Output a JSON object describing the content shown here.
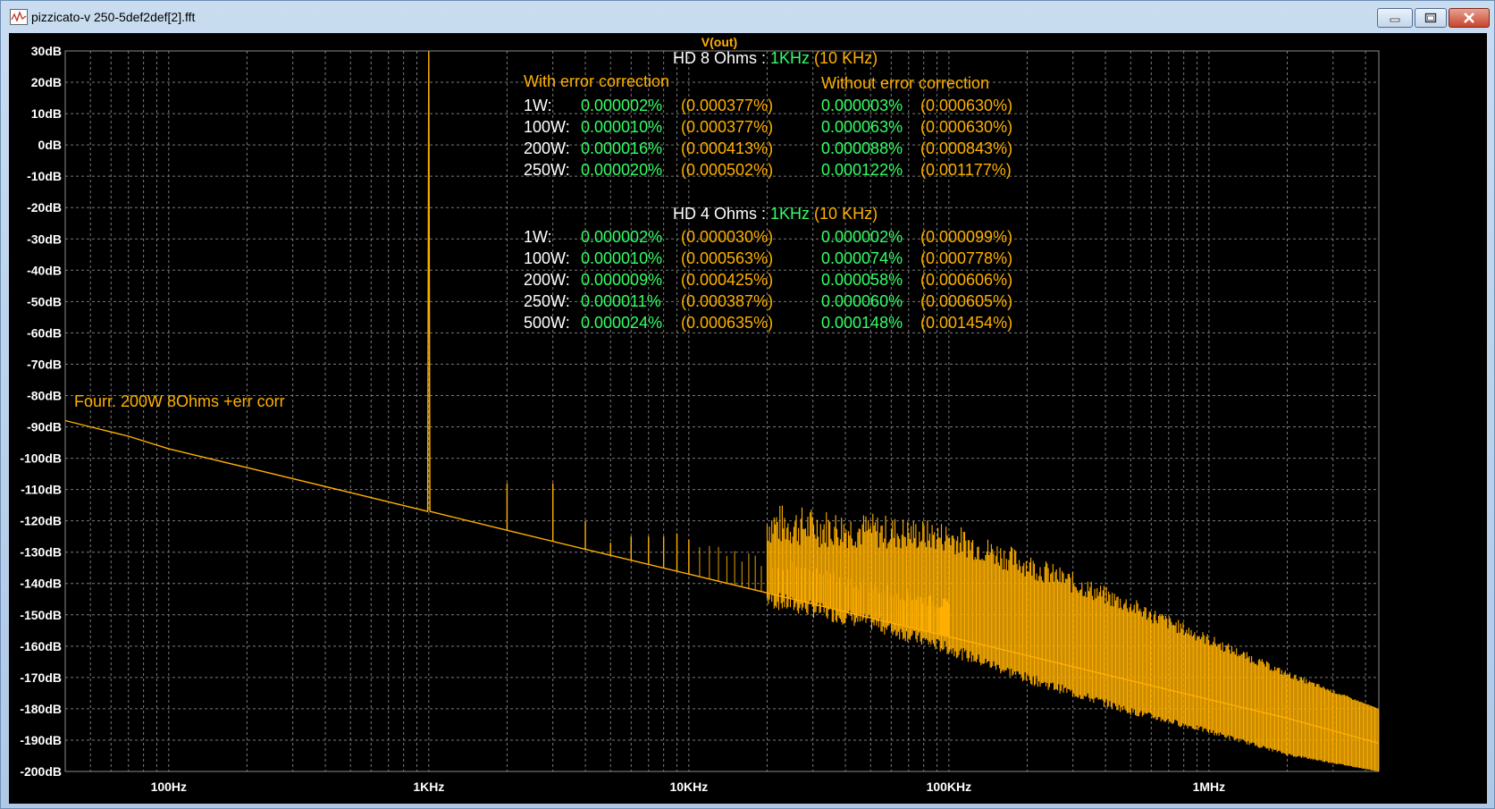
{
  "window": {
    "title": "pizzicato-v 250-5def2def[2].fft"
  },
  "colors": {
    "background": "#000000",
    "trace": "#ffb000",
    "grid": "#7a7a7a",
    "green_text": "#33ff66",
    "white_text": "#ffffff",
    "yellow_text": "#ffb000"
  },
  "icons": [
    "waveform-icon",
    "minimize-icon",
    "maximize-icon",
    "close-icon"
  ],
  "plot": {
    "trace_label": "V(out)",
    "x_ticks": [
      "100Hz",
      "1KHz",
      "10KHz",
      "100KHz",
      "1MHz"
    ],
    "y_ticks": [
      "30dB",
      "20dB",
      "10dB",
      "0dB",
      "-10dB",
      "-20dB",
      "-30dB",
      "-40dB",
      "-50dB",
      "-60dB",
      "-70dB",
      "-80dB",
      "-90dB",
      "-100dB",
      "-110dB",
      "-120dB",
      "-130dB",
      "-140dB",
      "-150dB",
      "-160dB",
      "-170dB",
      "-180dB",
      "-190dB",
      "-200dB"
    ],
    "annotation": "Fourr.  200W 8Ohms +err corr"
  },
  "hd8": {
    "title": "HD  8 Ohms : ",
    "fund": "1KHz",
    "alt": "  (10 KHz)",
    "with_label": "With error correction",
    "without_label": "Without error correction",
    "rows": [
      {
        "p": "1W:",
        "w1": "0.000002%",
        "w2": "(0.000377%)",
        "n1": "0.000003%",
        "n2": "(0.000630%)"
      },
      {
        "p": "100W:",
        "w1": "0.000010%",
        "w2": "(0.000377%)",
        "n1": "0.000063%",
        "n2": "(0.000630%)"
      },
      {
        "p": "200W:",
        "w1": "0.000016%",
        "w2": "(0.000413%)",
        "n1": "0.000088%",
        "n2": "(0.000843%)"
      },
      {
        "p": "250W:",
        "w1": "0.000020%",
        "w2": "(0.000502%)",
        "n1": "0.000122%",
        "n2": "(0.001177%)"
      }
    ]
  },
  "hd4": {
    "title": "HD 4 Ohms : ",
    "fund": "1KHz",
    "alt": " (10 KHz)",
    "rows": [
      {
        "p": "1W:",
        "w1": "0.000002%",
        "w2": "(0.000030%)",
        "n1": "0.000002%",
        "n2": "(0.000099%)"
      },
      {
        "p": "100W:",
        "w1": "0.000010%",
        "w2": "(0.000563%)",
        "n1": "0.000074%",
        "n2": "(0.000778%)"
      },
      {
        "p": "200W:",
        "w1": "0.000009%",
        "w2": "(0.000425%)",
        "n1": "0.000058%",
        "n2": "(0.000606%)"
      },
      {
        "p": "250W:",
        "w1": "0.000011%",
        "w2": "(0.000387%)",
        "n1": "0.000060%",
        "n2": "(0.000605%)"
      },
      {
        "p": "500W:",
        "w1": "0.000024%",
        "w2": "(0.000635%)",
        "n1": "0.000148%",
        "n2": "(0.001454%)"
      }
    ]
  },
  "chart_data": {
    "type": "line",
    "ylabel": "",
    "xlabel": "",
    "x_scale": "log",
    "xlim": [
      40,
      4500000
    ],
    "ylim": [
      -200,
      30
    ],
    "grid": true,
    "series": [
      {
        "name": "V(out)",
        "x": [
          40,
          50,
          70,
          100,
          200,
          500,
          990,
          1000,
          1010,
          2000,
          5000,
          10000,
          20000,
          50000,
          100000,
          200000,
          500000,
          1000000,
          2000000,
          4500000
        ],
        "y": [
          -88,
          -90,
          -93,
          -97,
          -103,
          -111,
          -117,
          30,
          -117,
          -123,
          -131,
          -137,
          -143,
          -151,
          -157,
          -163,
          -171,
          -177,
          -183,
          -191
        ]
      }
    ],
    "harmonics": {
      "x": [
        2000,
        3000,
        4000,
        5000,
        6000,
        7000,
        8000,
        9000,
        10000
      ],
      "y": [
        -108,
        -108,
        -120,
        -127,
        -125,
        -125,
        -125,
        -124,
        -126
      ]
    },
    "noise_floor": {
      "x": [
        20000,
        50000,
        100000,
        200000,
        500000,
        1000000,
        2000000,
        4500000
      ],
      "upper": [
        -128,
        -129,
        -130,
        -138,
        -150,
        -160,
        -170,
        -180
      ],
      "lower": [
        -148,
        -155,
        -163,
        -172,
        -182,
        -188,
        -195,
        -200
      ]
    }
  }
}
